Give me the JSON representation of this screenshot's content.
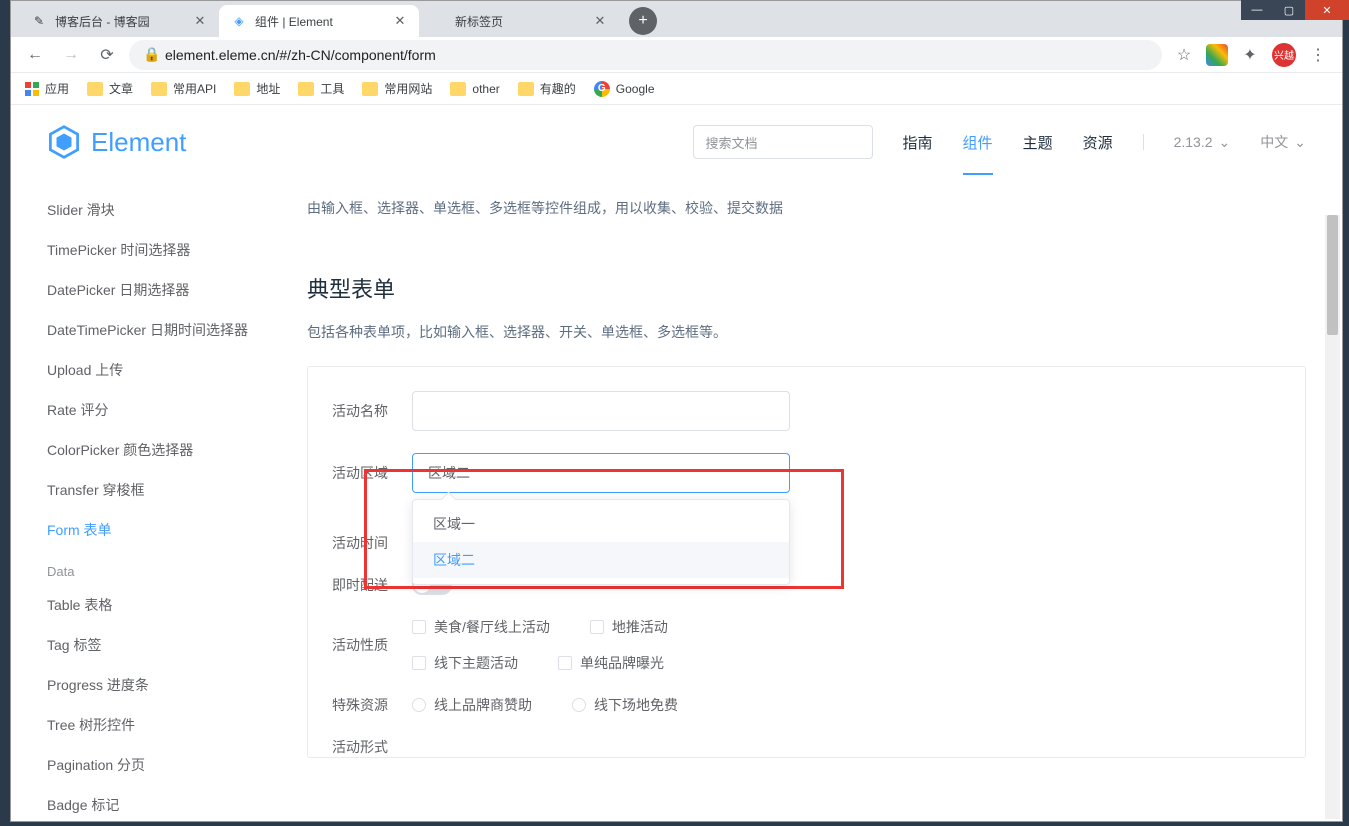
{
  "browser": {
    "tabs": [
      {
        "title": "博客后台 - 博客园"
      },
      {
        "title": "组件 | Element"
      },
      {
        "title": "新标签页"
      }
    ],
    "url": "element.eleme.cn/#/zh-CN/component/form",
    "bookmarks": {
      "apps": "应用",
      "items": [
        "文章",
        "常用API",
        "地址",
        "工具",
        "常用网站",
        "other",
        "有趣的",
        "Google"
      ]
    },
    "profile": "兴越"
  },
  "site": {
    "logo_text": "Element",
    "search_placeholder": "搜索文档",
    "nav": {
      "guide": "指南",
      "component": "组件",
      "theme": "主题",
      "resource": "资源"
    },
    "version": "2.13.2",
    "lang": "中文"
  },
  "sidebar": {
    "items": [
      "Slider 滑块",
      "TimePicker 时间选择器",
      "DatePicker 日期选择器",
      "DateTimePicker 日期时间选择器",
      "Upload 上传",
      "Rate 评分",
      "ColorPicker 颜色选择器",
      "Transfer 穿梭框",
      "Form 表单"
    ],
    "group_data": "Data",
    "data_items": [
      "Table 表格",
      "Tag 标签",
      "Progress 进度条",
      "Tree 树形控件",
      "Pagination 分页",
      "Badge 标记"
    ]
  },
  "content": {
    "intro": "由输入框、选择器、单选框、多选框等控件组成，用以收集、校验、提交数据",
    "section_title": "典型表单",
    "section_desc": "包括各种表单项，比如输入框、选择器、开关、单选框、多选框等。",
    "form": {
      "name_label": "活动名称",
      "region_label": "活动区域",
      "region_value": "区域二",
      "region_options": [
        "区域一",
        "区域二"
      ],
      "time_label": "活动时间",
      "delivery_label": "即时配送",
      "nature_label": "活动性质",
      "nature_options": [
        "美食/餐厅线上活动",
        "地推活动",
        "线下主题活动",
        "单纯品牌曝光"
      ],
      "resource_label": "特殊资源",
      "resource_options": [
        "线上品牌商赞助",
        "线下场地免费"
      ],
      "form_label": "活动形式"
    }
  }
}
